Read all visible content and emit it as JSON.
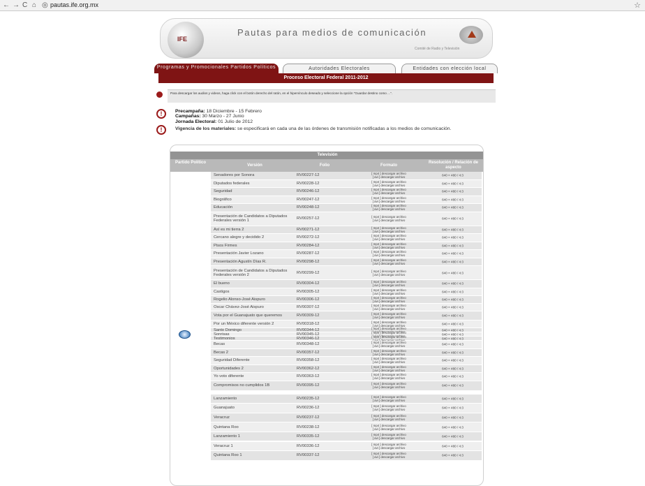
{
  "browser": {
    "url": "pautas.ife.org.mx"
  },
  "banner": {
    "title": "Pautas para medios de comunicación",
    "subtitle": "Comité de Radio y Televisión",
    "logo": "IFE"
  },
  "tabs": [
    {
      "label": "Programas y Promocionales Partidos Políticos",
      "active": true
    },
    {
      "label": "Autoridades Electorales"
    },
    {
      "label": "Entidades con elección local"
    }
  ],
  "process_title": "Proceso Electoral Federal 2011-2012",
  "notice": "Para descargar los audios y videos, haga click con el botón derecho del ratón, en el hipervínculo deseado y seleccione la opción \"Guardar destino como ...\".",
  "info": {
    "precampana_label": "Precampaña:",
    "precampana": "18 Diciembre - 15 Febrero",
    "campanas_label": "Campañas:",
    "campanas": "30 Marzo - 27 Junio",
    "jornada_label": "Jornada Electoral:",
    "jornada": "01 Julio de 2012",
    "vigencia_label": "Vigencia de los materiales:",
    "vigencia": "se especificará en cada una de las órdenes de transmisión notificadas a los medios de comunicación."
  },
  "table": {
    "section": "Televisión",
    "headers": {
      "partido": "Partido Político",
      "version": "Versión",
      "folio": "Folio",
      "formato": "Formato",
      "resolucion": "Resolución / Relación de aspecto"
    },
    "format_lines": [
      "[ mp4 ] descargar archivo",
      "[ avi ] descargar archivo"
    ],
    "rows": [
      [
        "Senadores por Sonora",
        "RV00227-12",
        "640 × 480 / 4:3"
      ],
      [
        "Diputados federales",
        "RV00228-12",
        "640 × 480 / 4:3"
      ],
      [
        "Seguridad",
        "RV00246-12",
        "640 × 480 / 4:3"
      ],
      [
        "Biográfico",
        "RV00247-12",
        "640 × 480 / 4:3"
      ],
      [
        "Educación",
        "RV00248-12",
        "640 × 480 / 4:3"
      ],
      [
        "Presentación de Candidatos a Diputados Federales versión 1",
        "RV00257-12",
        "640 × 480 / 4:3"
      ],
      [
        "Así es mi tierra 2",
        "RV00271-12",
        "640 × 480 / 4:3"
      ],
      [
        "Cercano alegre y decidido 2",
        "RV00272-12",
        "640 × 480 / 4:3"
      ],
      [
        "Pisos Firmes",
        "RV00284-12",
        "640 × 480 / 4:3"
      ],
      [
        "Presentación Javier Lozano",
        "RV00287-12",
        "640 × 480 / 4:3"
      ],
      [
        "Presentación Agustín Días R.",
        "RV00298-12",
        "640 × 480 / 4:3"
      ],
      [
        "Presentación de Candidatos a Diputados Federales versión 2",
        "RV00299-12",
        "640 × 480 / 4:3"
      ],
      [
        "El bueno",
        "RV00304-12",
        "640 × 480 / 4:3"
      ],
      [
        "Castigos",
        "RV00305-12",
        "640 × 480 / 4:3"
      ],
      [
        "Rogelio Alonso-José Aispuro",
        "RV00306-12",
        "640 × 480 / 4:3"
      ],
      [
        "Oscar Chávez-José Aispuro",
        "RV00307-12",
        "640 × 480 / 4:3"
      ],
      [
        "Vota por el Guanajuato que queremos",
        "RV00309-12",
        "640 × 480 / 4:3"
      ],
      [
        "Por un México diferente versión 2",
        "RV00318-12",
        "640 × 480 / 4:3"
      ],
      [
        "Santo Domingo",
        "RV00344-12",
        "640 × 480 / 4:3"
      ],
      [
        "Sonrisas",
        "RV00345-12",
        "640 × 480 / 4:3"
      ],
      [
        "Testimonios",
        "RV00346-12",
        "640 × 480 / 4:3"
      ],
      [
        "Becas",
        "RV00348-12",
        "640 × 480 / 4:3"
      ],
      [
        "Becas 2",
        "RV00357-12",
        "640 × 480 / 4:3"
      ],
      [
        "Seguridad Diferente",
        "RV00358-12",
        "640 × 480 / 4:3"
      ],
      [
        "Oportunidades 2",
        "RV00362-12",
        "640 × 480 / 4:3"
      ],
      [
        "Yo voto diferente",
        "RV00363-12",
        "640 × 480 / 4:3"
      ],
      [
        "Compromisos no cumplidos 1B",
        "RV00395-12",
        "640 × 480 / 4:3"
      ]
    ],
    "rows2": [
      [
        "Lanzamiento",
        "RV00235-12",
        "640 × 480 / 4:3"
      ],
      [
        "Guanajuato",
        "RV00236-12",
        "640 × 480 / 4:3"
      ],
      [
        "Veracruz",
        "RV00237-12",
        "640 × 480 / 4:3"
      ],
      [
        "Quintana Roo",
        "RV00238-12",
        "640 × 480 / 4:3"
      ],
      [
        "Lanzamiento 1",
        "RV00335-12",
        "640 × 480 / 4:3"
      ],
      [
        "Veracruz 1",
        "RV00336-12",
        "640 × 480 / 4:3"
      ],
      [
        "Quintana Roo 1",
        "RV00337-12",
        "640 × 480 / 4:3"
      ]
    ]
  }
}
